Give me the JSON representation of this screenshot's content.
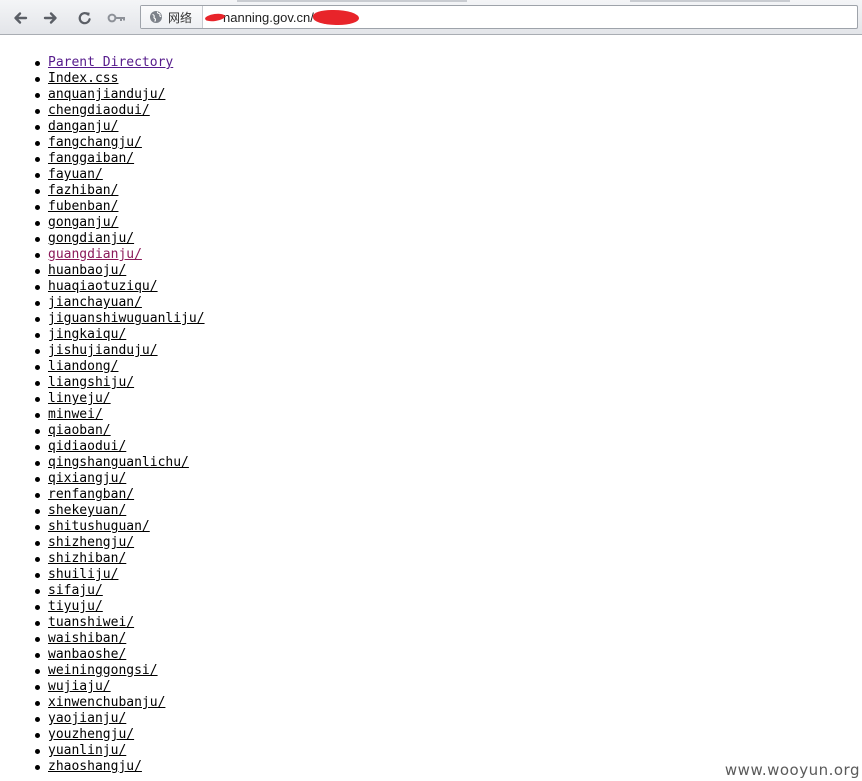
{
  "browser": {
    "chip_label": "网络",
    "url_text": "nanning.gov.cn/",
    "icons": [
      "back-arrow-icon",
      "forward-arrow-icon",
      "reload-icon",
      "key-icon",
      "globe-icon"
    ]
  },
  "listing": {
    "parent_link": "Parent Directory",
    "entries": [
      "Index.css",
      "anquanjianduju/",
      "chengdiaodui/",
      "danganju/",
      "fangchangju/",
      "fanggaiban/",
      "fayuan/",
      "fazhiban/",
      "fubenban/",
      "gonganju/",
      "gongdianju/",
      "guangdianju/",
      "huanbaoju/",
      "huaqiaotuziqu/",
      "jianchayuan/",
      "jiguanshiwuguanliju/",
      "jingkaiqu/",
      "jishujianduju/",
      "liandong/",
      "liangshiju/",
      "linyeju/",
      "minwei/",
      "qiaoban/",
      "qidiaodui/",
      "qingshanguanlichu/",
      "qixiangju/",
      "renfangban/",
      "shekeyuan/",
      "shitushuguan/",
      "shizhengju/",
      "shizhiban/",
      "shuiliju/",
      "sifaju/",
      "tiyuju/",
      "tuanshiwei/",
      "waishiban/",
      "wanbaoshe/",
      "weininggongsi/",
      "wujiaju/",
      "xinwenchubanju/",
      "yaojianju/",
      "youzhengju/",
      "yuanlinju/",
      "zhaoshangju/"
    ],
    "highlighted_entry_index": 11,
    "colors": {
      "link": "#000000",
      "visited": "#551a8b",
      "highlighted": "#8b1a5a"
    }
  },
  "watermark": "www.wooyun.org"
}
